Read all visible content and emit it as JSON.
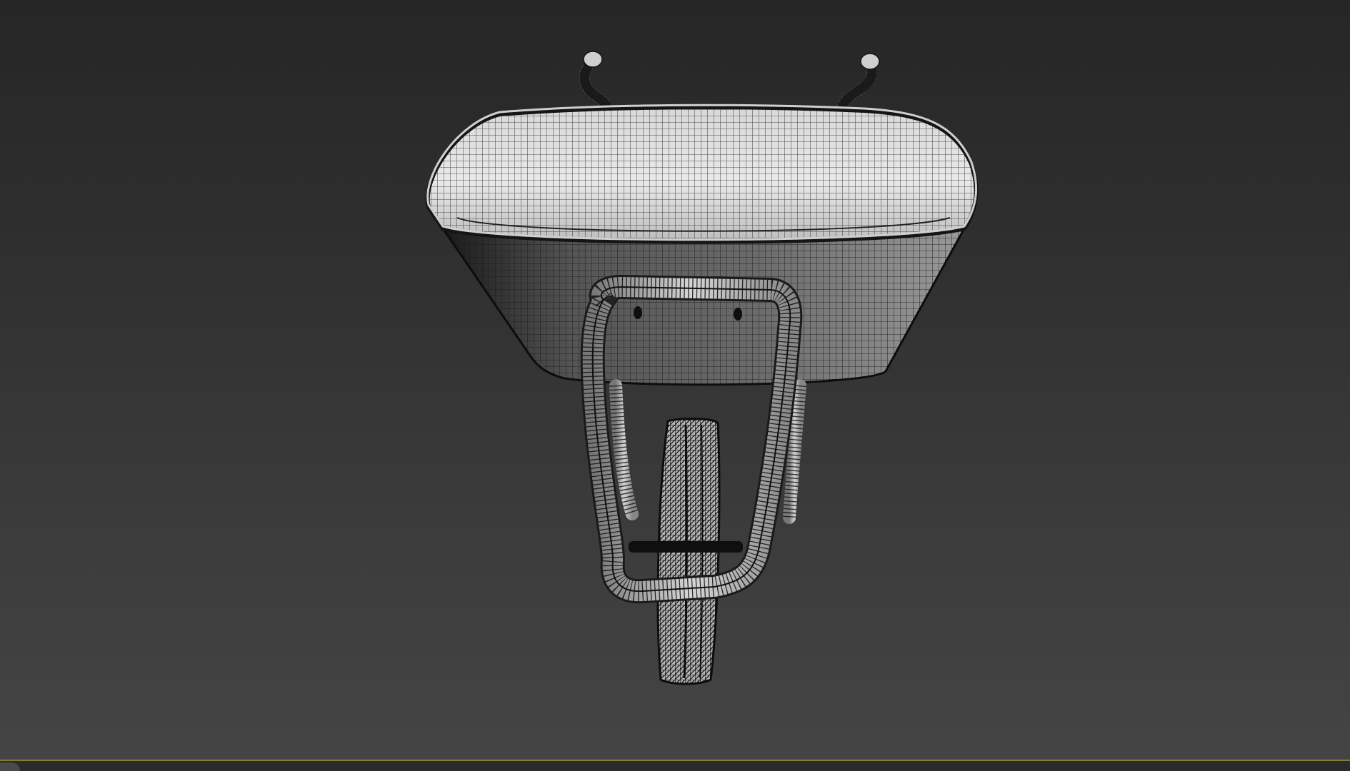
{
  "viewport": {
    "kind": "3d-perspective-viewport",
    "shading_mode": "edged-faces",
    "background_top": "#262626",
    "background_bottom": "#454545",
    "active_border_color": "#8a7a3a"
  },
  "scene": {
    "object": "wheelbarrow",
    "parts": [
      "tray",
      "handle-left",
      "handle-right",
      "frame-loop",
      "leg-left",
      "leg-right",
      "axle",
      "wheel"
    ],
    "mesh_color": "#c8c8c8",
    "wire_color": "#111111"
  }
}
